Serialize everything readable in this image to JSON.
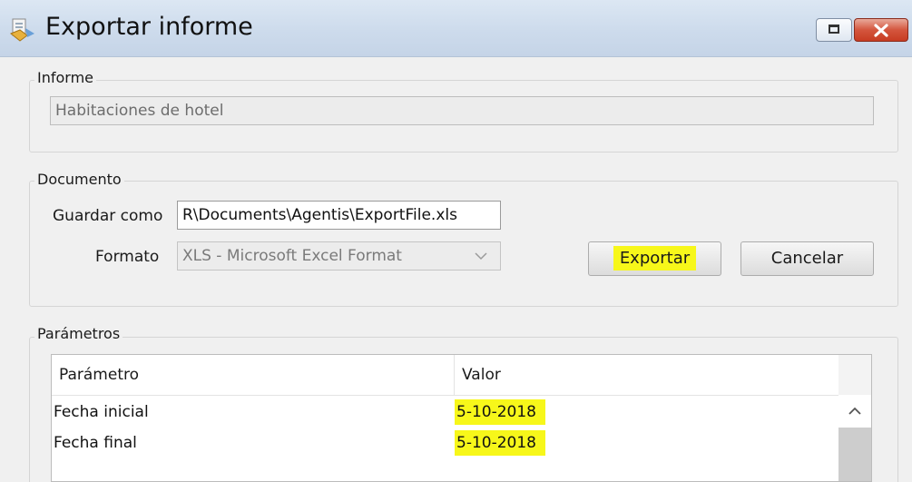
{
  "window": {
    "title": "Exportar informe",
    "icon": "export-app-icon",
    "controls": [
      "restore-icon",
      "close-icon"
    ]
  },
  "informe": {
    "group_label": "Informe",
    "report_name": "Habitaciones de hotel"
  },
  "documento": {
    "group_label": "Documento",
    "save_as_label": "Guardar como",
    "save_as_value": "R\\Documents\\Agentis\\ExportFile.xls",
    "format_label": "Formato",
    "format_value": "XLS - Microsoft Excel Format",
    "export_button": "Exportar",
    "cancel_button": "Cancelar"
  },
  "parametros": {
    "group_label": "Parámetros",
    "columns": [
      "Parámetro",
      "Valor"
    ],
    "rows": [
      {
        "param": "Fecha inicial",
        "value": "5-10-2018"
      },
      {
        "param": "Fecha final",
        "value": "5-10-2018"
      }
    ]
  },
  "colors": {
    "highlight": "#f7f71a",
    "titlebar": "#cddbec",
    "close_button": "#c73c22"
  }
}
